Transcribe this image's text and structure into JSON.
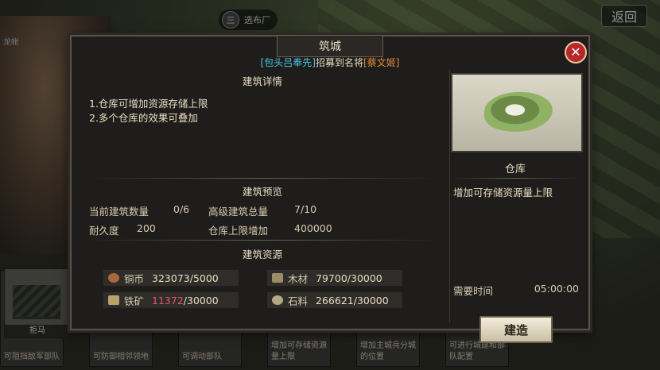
{
  "topbar": {
    "pill_icon": "三",
    "pill_text": "选布厂",
    "back_label": "返回",
    "left_tag": "龙帐"
  },
  "dialog": {
    "title": "筑城",
    "announcement": {
      "prefix": "[包头吕奉先]",
      "middle": "招募到名将",
      "suffix": "[蔡文姬]"
    },
    "details_title": "建筑详情",
    "details": [
      "1.仓库可增加资源存储上限",
      "2.多个仓库的效果可叠加"
    ],
    "preview_title": "建筑预览",
    "preview": {
      "count_label": "当前建筑数量",
      "count_value": "0/6",
      "advanced_label": "高级建筑总量",
      "advanced_value": "7/10",
      "durability_label": "耐久度",
      "durability_value": "200",
      "capacity_label": "仓库上限增加",
      "capacity_value": "400000"
    },
    "resources_title": "建筑资源",
    "resources": {
      "copper": {
        "label": "铜币",
        "current": "323073",
        "required": "5000",
        "icon": "coin-icon"
      },
      "wood": {
        "label": "木材",
        "current": "79700",
        "required": "30000",
        "icon": "wood-icon"
      },
      "iron": {
        "label": "铁矿",
        "current": "11372",
        "required": "30000",
        "icon": "anvil-icon"
      },
      "stone": {
        "label": "石料",
        "current": "266621",
        "required": "30000",
        "icon": "stone-icon"
      }
    },
    "building_name": "仓库",
    "building_desc": "增加可存储资源量上限",
    "time_label": "需要时间",
    "time_value": "05:00:00",
    "build_label": "建造",
    "colors": {
      "cyan": "#4dc6e6",
      "orange": "#e68b3c",
      "red": "#e4576b",
      "close": "#b8282a"
    }
  },
  "bottom": {
    "selected_card": "拒马",
    "cards": [
      "可阻挡敌军部队",
      "可防御相邻领地",
      "可调动部队",
      "增加可存储资源量上限",
      "增加主城兵分城的位置",
      "可进行城建和部队配置"
    ]
  }
}
